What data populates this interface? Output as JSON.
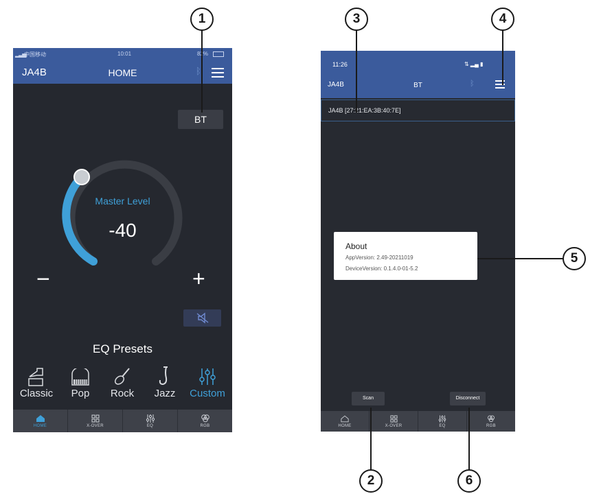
{
  "home_screen": {
    "status_bar": {
      "carrier": "中国移动",
      "time": "10:01",
      "battery": "82%"
    },
    "app_bar": {
      "device": "JA4B",
      "title": "HOME"
    },
    "bt_button": "BT",
    "master_level": {
      "label": "Master Level",
      "value": "-40"
    },
    "minus_symbol": "−",
    "plus_symbol": "+",
    "eq_presets_title": "EQ Presets",
    "presets": [
      {
        "label": "Classic",
        "icon": "gramophone-icon"
      },
      {
        "label": "Pop",
        "icon": "piano-icon"
      },
      {
        "label": "Rock",
        "icon": "guitar-icon"
      },
      {
        "label": "Jazz",
        "icon": "saxophone-icon"
      },
      {
        "label": "Custom",
        "icon": "sliders-icon",
        "active": true
      }
    ],
    "nav": [
      "HOME",
      "X-OVER",
      "EQ",
      "RGB"
    ],
    "active_nav": "HOME"
  },
  "bt_screen": {
    "status_bar": {
      "time": "11:26"
    },
    "app_bar": {
      "device": "JA4B",
      "title": "BT"
    },
    "device_entry": "JA4B [27:21:EA:3B:40:7E]",
    "about": {
      "title": "About",
      "app_version": "AppVersion: 2.49-20211019",
      "device_version": "DeviceVersion: 0.1.4.0-01-5.2"
    },
    "scan_button": "Scan",
    "disconnect_button": "Disconnect",
    "nav": [
      "HOME",
      "X-OVER",
      "EQ",
      "RGB"
    ]
  },
  "callouts": [
    "1",
    "2",
    "3",
    "4",
    "5",
    "6"
  ],
  "colors": {
    "app_bar": "#3b5b9c",
    "background": "#25282f",
    "accent": "#3fa0d8",
    "dial_track": "#3a3d44"
  }
}
